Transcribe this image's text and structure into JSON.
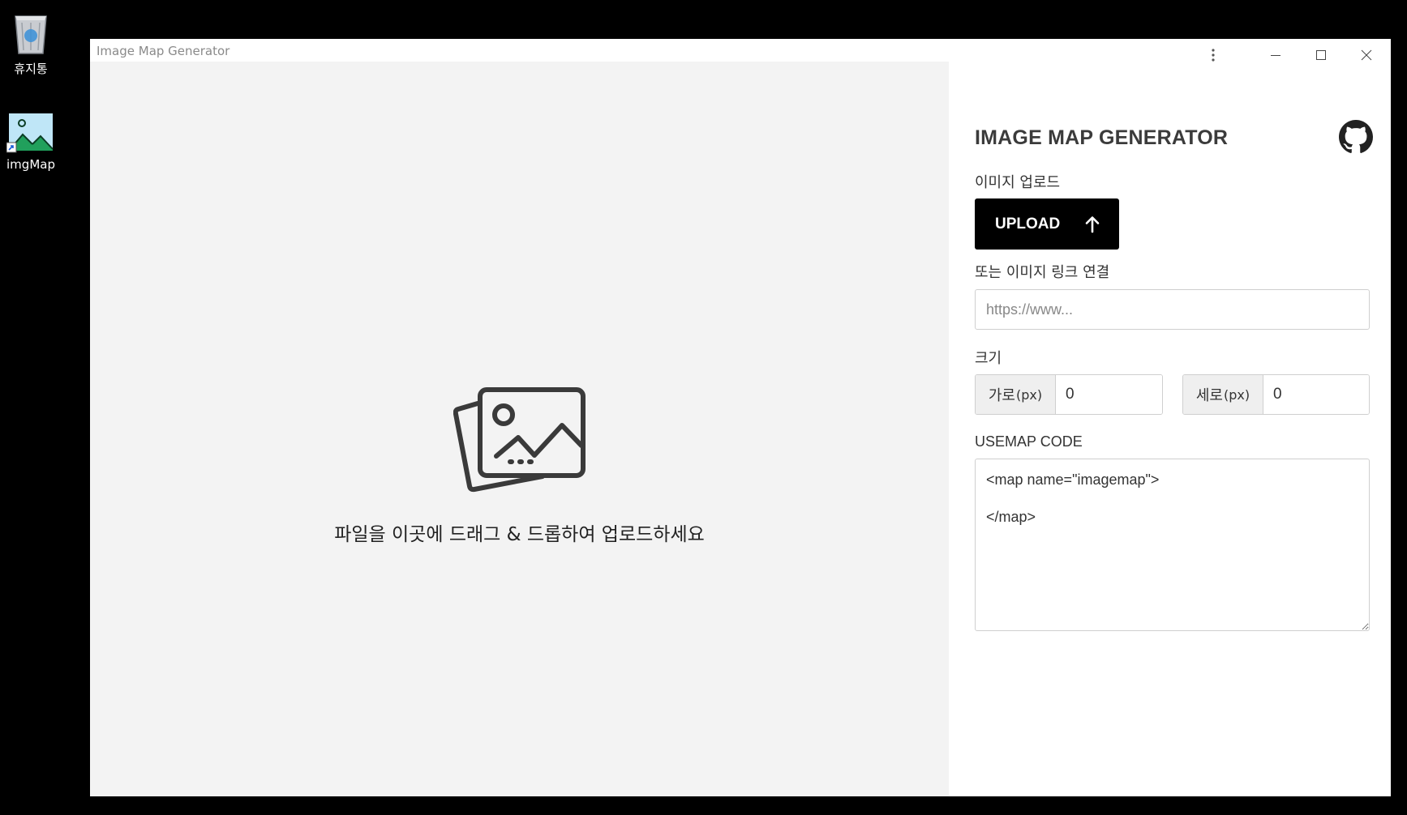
{
  "desktop": {
    "icons": [
      {
        "name": "recycle-bin",
        "label": "휴지통"
      },
      {
        "name": "imgmap-shortcut",
        "label": "imgMap"
      }
    ]
  },
  "window": {
    "title": "Image Map Generator",
    "controls": {
      "more": "more-icon",
      "minimize": "minimize-icon",
      "maximize": "maximize-icon",
      "close": "close-icon"
    }
  },
  "dropzone": {
    "icon": "images-icon",
    "text": "파일을 이곳에 드래그 & 드롭하여 업로드하세요"
  },
  "panel": {
    "title": "IMAGE MAP GENERATOR",
    "github_icon": "github-icon",
    "upload": {
      "label": "이미지 업로드",
      "button": "UPLOAD",
      "button_icon": "arrow-up-icon"
    },
    "link": {
      "label": "또는 이미지 링크 연결",
      "placeholder": "https://www...",
      "value": ""
    },
    "size": {
      "label": "크기",
      "width_label": "가로",
      "height_label": "세로",
      "unit": "(px)",
      "width_value": "0",
      "height_value": "0"
    },
    "code": {
      "label": "USEMAP CODE",
      "value": "<map name=\"imagemap\">\n\n</map>"
    }
  },
  "colors": {
    "desktop_bg": "#000000",
    "dropzone_bg": "#f3f3f3",
    "upload_button_bg": "#000000",
    "title_text": "#3b3b3b"
  }
}
